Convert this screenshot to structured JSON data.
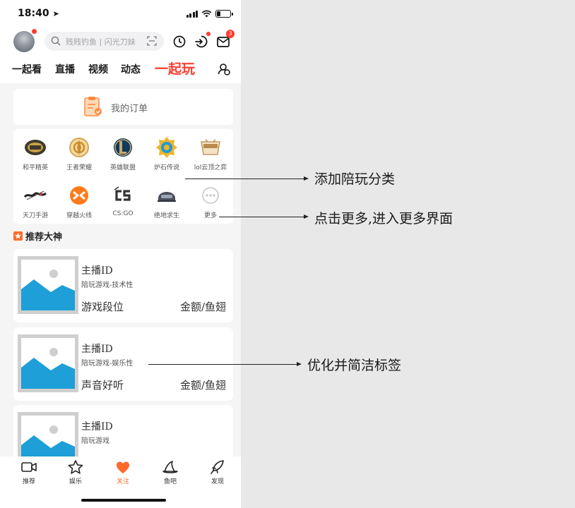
{
  "status_bar": {
    "time": "18:40"
  },
  "header": {
    "search_placeholder": "贱贱钓鱼 | 闪光刀妹",
    "mail_badge": "3",
    "tabs": [
      {
        "label": "一起看"
      },
      {
        "label": "直播"
      },
      {
        "label": "视频"
      },
      {
        "label": "动态"
      },
      {
        "label": "一起玩",
        "active": true
      }
    ]
  },
  "order": {
    "label": "我的订单"
  },
  "categories": [
    {
      "label": "和平精英",
      "icon": "pubg-mobile-icon"
    },
    {
      "label": "王者荣耀",
      "icon": "honor-of-kings-icon"
    },
    {
      "label": "英雄联盟",
      "icon": "league-of-legends-icon"
    },
    {
      "label": "炉石传说",
      "icon": "hearthstone-icon"
    },
    {
      "label": "lol云顶之弈",
      "icon": "tft-icon"
    },
    {
      "label": "天刀手游",
      "icon": "tiandao-icon"
    },
    {
      "label": "穿越火线",
      "icon": "crossfire-icon"
    },
    {
      "label": "CS:GO",
      "icon": "csgo-icon"
    },
    {
      "label": "绝地求生",
      "icon": "pubg-icon"
    },
    {
      "label": "更多",
      "icon": "more-icon"
    }
  ],
  "recommend": {
    "title": "推荐大神",
    "cards": [
      {
        "name": "主播ID",
        "tag": "陪玩游戏-技术性",
        "rank": "游戏段位",
        "price": "金额/鱼翅"
      },
      {
        "name": "主播ID",
        "tag": "陪玩游戏-娱乐性",
        "rank": "声音好听",
        "price": "金额/鱼翅"
      },
      {
        "name": "主播ID",
        "tag": "陪玩游戏",
        "rank": "",
        "price": ""
      }
    ]
  },
  "tabbar": [
    {
      "label": "推荐"
    },
    {
      "label": "娱乐"
    },
    {
      "label": "关注",
      "active": true
    },
    {
      "label": "鱼吧"
    },
    {
      "label": "发现"
    }
  ],
  "annotations": [
    {
      "text": "添加陪玩分类"
    },
    {
      "text": "点击更多,进入更多界面"
    },
    {
      "text": "优化并简洁标签"
    }
  ],
  "colors": {
    "accent": "#ff3b2f",
    "orange": "#ff6a2b",
    "placeholder_blue": "#1e9fd8"
  }
}
